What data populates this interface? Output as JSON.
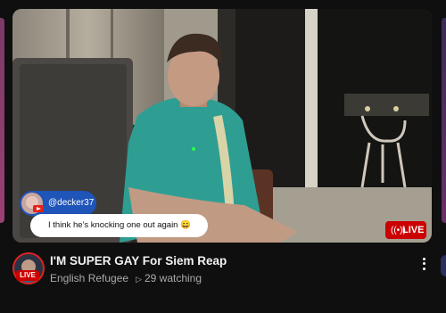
{
  "chat": {
    "username": "@decker37",
    "message": "I think he's knocking one out again 😄"
  },
  "thumbnail": {
    "live_label": "LIVE"
  },
  "video": {
    "channel_live_label": "LIVE",
    "title": "I'M SUPER GAY For Siem Reap",
    "channel": "English Refugee",
    "watching": "29 watching"
  },
  "colors": {
    "live_red": "#cc0000",
    "chat_blue": "#1f54b8",
    "background": "#0f0f0f"
  },
  "icons": [
    "live-radio-icon",
    "youtube-icon",
    "play-icon",
    "more-options-icon"
  ]
}
